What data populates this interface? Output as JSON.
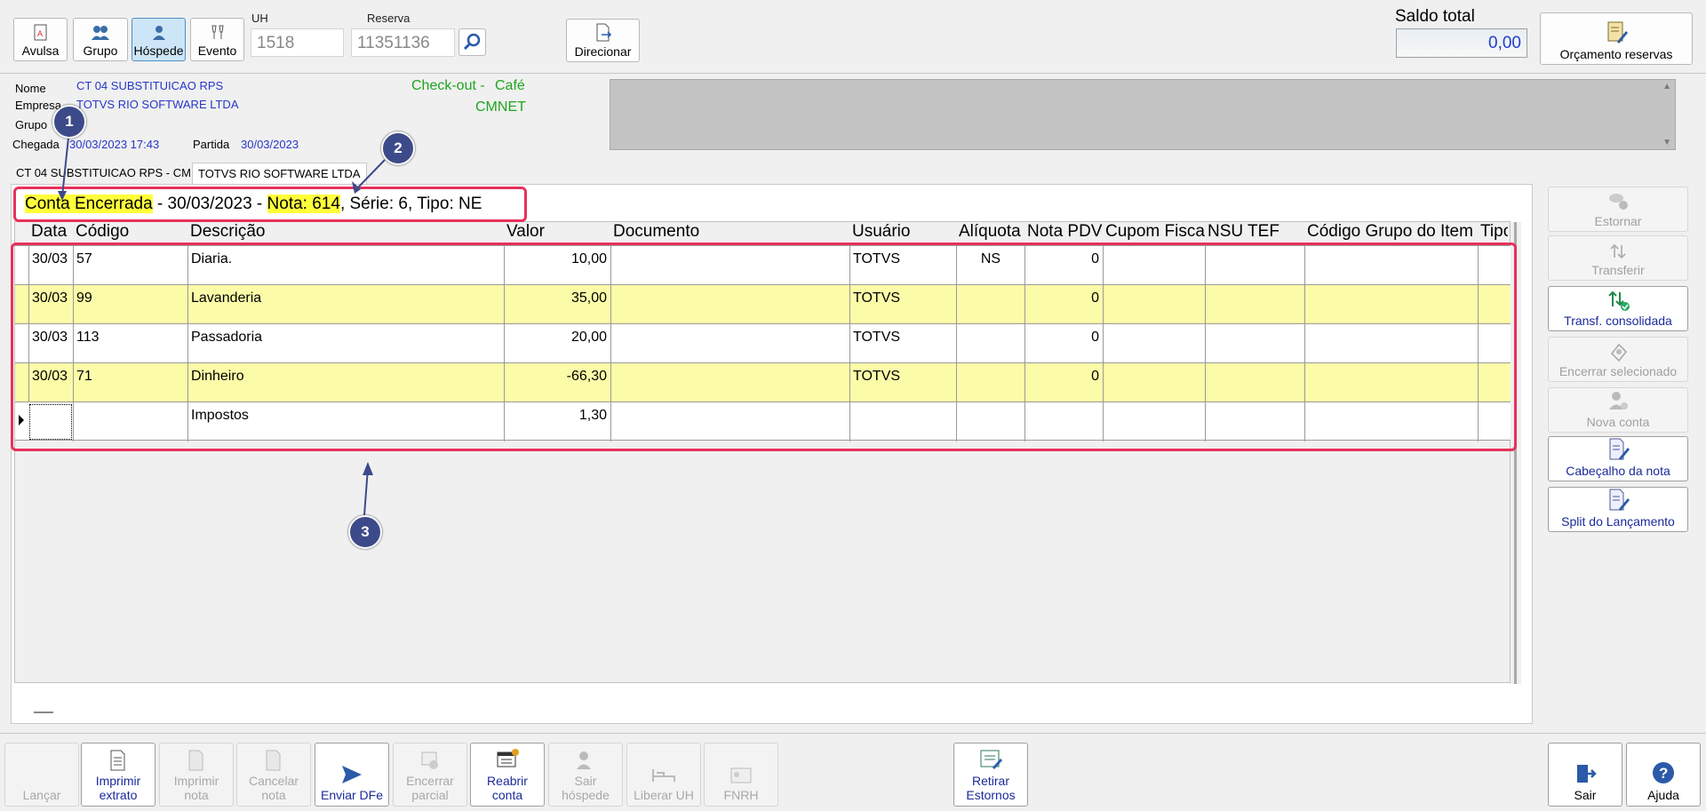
{
  "toolbar": {
    "avulsa": "Avulsa",
    "grupo": "Grupo",
    "hospede": "Hóspede",
    "evento": "Evento",
    "uh_label": "UH",
    "uh_value": "1518",
    "reserva_label": "Reserva",
    "reserva_value": "11351136",
    "direcionar": "Direcionar",
    "saldo_label": "Saldo total",
    "saldo_value": "0,00",
    "orcamento": "Orçamento reservas"
  },
  "info": {
    "nome_label": "Nome",
    "nome": "CT 04 SUBSTITUICAO RPS",
    "empresa_label": "Empresa",
    "empresa": "TOTVS RIO SOFTWARE LTDA",
    "grupo_label": "Grupo",
    "chegada_label": "Chegada",
    "chegada": "30/03/2023 17:43",
    "partida_label": "Partida",
    "partida": "30/03/2023",
    "checkout": "Check-out -",
    "cafe": "Café",
    "cmnet": "CMNET"
  },
  "tabs": [
    "CT 04 SUBSTITUICAO RPS - CM",
    "TOTVS RIO SOFTWARE LTDA"
  ],
  "status": {
    "conta": "Conta Encerrada",
    "date_part": " - 30/03/2023 - ",
    "nota": "Nota: 614",
    "rest": ", Série: 6, Tipo: NE"
  },
  "grid": {
    "columns": [
      "Data",
      "Código",
      "Descrição",
      "Valor",
      "Documento",
      "Usuário",
      "Alíquota",
      "Nota PDV",
      "Cupom Fiscal",
      "NSU TEF",
      "Código Grupo do Item",
      "Tipo"
    ],
    "rows": [
      {
        "data": "30/03",
        "codigo": "57",
        "descricao": "Diaria.",
        "valor": "10,00",
        "usuario": "TOTVS",
        "aliquota": "NS",
        "nota_pdv": "0"
      },
      {
        "data": "30/03",
        "codigo": "99",
        "descricao": "Lavanderia",
        "valor": "35,00",
        "usuario": "TOTVS",
        "aliquota": "",
        "nota_pdv": "0"
      },
      {
        "data": "30/03",
        "codigo": "113",
        "descricao": "Passadoria",
        "valor": "20,00",
        "usuario": "TOTVS",
        "aliquota": "",
        "nota_pdv": "0"
      },
      {
        "data": "30/03",
        "codigo": "71",
        "descricao": "Dinheiro",
        "valor": "-66,30",
        "usuario": "TOTVS",
        "aliquota": "",
        "nota_pdv": "0"
      },
      {
        "data": "",
        "codigo": "",
        "descricao": "Impostos",
        "valor": "1,30",
        "usuario": "",
        "aliquota": "",
        "nota_pdv": ""
      }
    ]
  },
  "side_buttons": {
    "estornar": "Estornar",
    "transferir": "Transferir",
    "transf_consolidada": "Transf. consolidada",
    "encerrar_selecionado": "Encerrar selecionado",
    "nova_conta": "Nova conta",
    "cabecalho": "Cabeçalho da nota",
    "split": "Split do Lançamento"
  },
  "bottom_buttons": {
    "lancar": "Lançar",
    "imprimir_extrato_1": "Imprimir",
    "imprimir_extrato_2": "extrato",
    "imprimir_nota_1": "Imprimir",
    "imprimir_nota_2": "nota",
    "cancelar_nota_1": "Cancelar",
    "cancelar_nota_2": "nota",
    "enviar_dfe": "Enviar DFe",
    "encerrar_parcial_1": "Encerrar",
    "encerrar_parcial_2": "parcial",
    "reabrir_conta_1": "Reabrir",
    "reabrir_conta_2": "conta",
    "sair_hospede_1": "Sair",
    "sair_hospede_2": "hóspede",
    "liberar_uh": "Liberar UH",
    "fnrh": "FNRH",
    "retirar_estornos_1": "Retirar",
    "retirar_estornos_2": "Estornos",
    "sair": "Sair",
    "ajuda": "Ajuda"
  },
  "annotations": [
    "1",
    "2",
    "3"
  ],
  "colors": {
    "highlight": "#ffff3a",
    "row_yellow": "#fcfca8",
    "annotation_red": "#e8315b",
    "badge": "#3d4a8a",
    "link_blue": "#2636c8",
    "green": "#1fa51f"
  }
}
